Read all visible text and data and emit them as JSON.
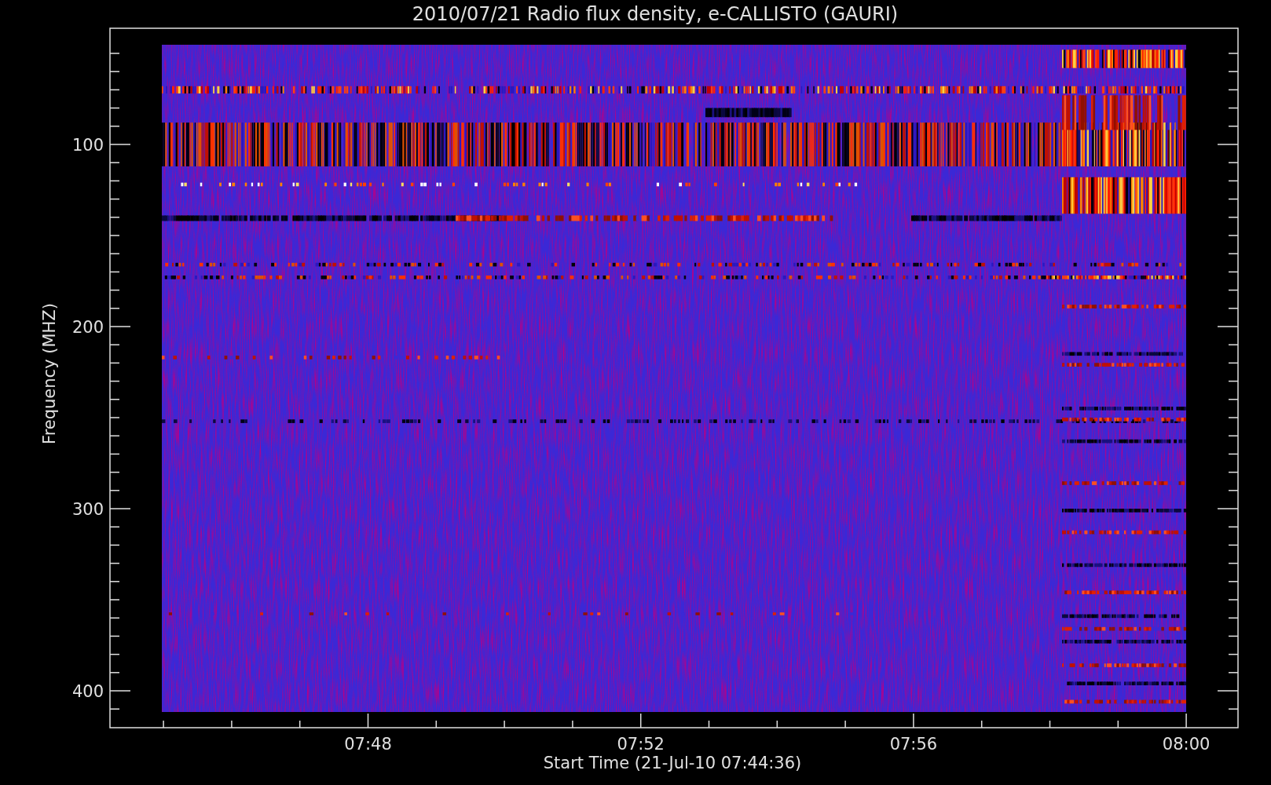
{
  "title": "2010/07/21  Radio flux density, e-CALLISTO (GAURI)",
  "y_axis": {
    "label": "Frequency (MHZ)",
    "ticks": [
      "100",
      "200",
      "300",
      "400"
    ]
  },
  "x_axis": {
    "label": "Start Time (21-Jul-10 07:44:36)",
    "ticks": [
      "07:48",
      "07:52",
      "07:56",
      "08:00"
    ]
  }
}
